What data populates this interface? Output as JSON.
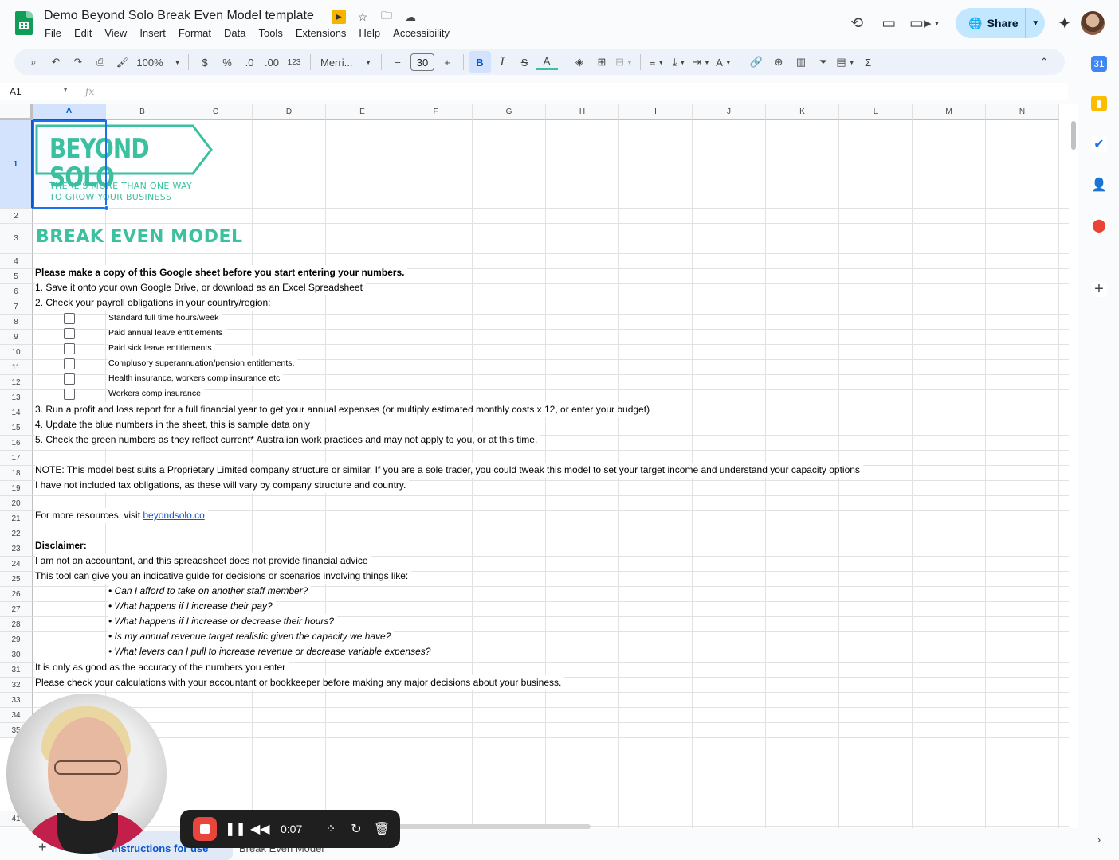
{
  "app": {
    "title": "Demo Beyond Solo Break Even Model template",
    "menu": [
      "File",
      "Edit",
      "View",
      "Insert",
      "Format",
      "Data",
      "Tools",
      "Extensions",
      "Help",
      "Accessibility"
    ],
    "share_label": "Share"
  },
  "toolbar": {
    "zoom": "100%",
    "currency": "$",
    "percent": "%",
    "dec_decrease": ".0",
    "dec_increase": ".00",
    "number_format": "123",
    "font": "Merri...",
    "font_size": "30",
    "bold": "B",
    "italic": "I",
    "strike": "S",
    "text_color": "A"
  },
  "formula": {
    "cell_ref": "A1",
    "fx": "fx"
  },
  "columns": [
    "A",
    "B",
    "C",
    "D",
    "E",
    "F",
    "G",
    "H",
    "I",
    "J",
    "K",
    "L",
    "M",
    "N"
  ],
  "rows": [
    "1",
    "2",
    "3",
    "4",
    "5",
    "6",
    "7",
    "8",
    "9",
    "10",
    "11",
    "12",
    "13",
    "14",
    "15",
    "16",
    "17",
    "18",
    "19",
    "20",
    "21",
    "22",
    "23",
    "24",
    "25",
    "26",
    "27",
    "28",
    "29",
    "30",
    "31",
    "32",
    "33",
    "34",
    "35",
    "41"
  ],
  "logo": {
    "name": "BEYOND SOLO",
    "tagline1": "THERE'S MORE THAN ONE WAY",
    "tagline2": "TO GROW YOUR BUSINESS"
  },
  "content": {
    "title": "BREAK EVEN MODEL",
    "r5": "Please make a copy of this Google sheet before you start entering your numbers.",
    "r6": "1. Save it onto your own Google Drive, or download as an Excel Spreadsheet",
    "r7": "2. Check your payroll obligations in your country/region:",
    "checklist": [
      "Standard full time hours/week",
      "Paid annual leave entitlements",
      "Paid sick leave entitlements",
      "Complusory superannuation/pension entitlements,",
      "Health insurance, workers comp insurance etc",
      "Workers comp insurance"
    ],
    "r14": "3. Run a profit and loss report for a full financial year to get your annual expenses (or multiply estimated monthly costs x 12, or enter your budget)",
    "r15": "4. Update the blue numbers in the sheet, this is sample data only",
    "r16": "5. Check the green numbers as they reflect current* Australian work practices and may not apply to you, or at this time.",
    "r18": "NOTE: This model best suits a Proprietary Limited company structure or similar. If you are a sole trader, you could tweak this model to set your target income and understand your capacity options",
    "r19": "I have not included tax obligations, as these will vary by company structure and country.",
    "r21_prefix": "For more resources, visit ",
    "r21_link": "beyondsolo.co",
    "r23": "Disclaimer:",
    "r24": "I am not an accountant, and this spreadsheet does not provide financial advice",
    "r25": "This tool can give you an indicative guide for decisions or scenarios involving things like:",
    "bullets": [
      "• Can I afford to take on another staff member?",
      "• What happens if I increase their pay?",
      "• What happens if I increase or decrease their hours?",
      "• Is my annual revenue target realistic given the capacity we have?",
      "• What levers can I pull to increase revenue or decrease variable expenses?"
    ],
    "r31": "It is only as good as the accuracy of the numbers you enter",
    "r32": "Please check your calculations with your accountant or bookkeeper before making any major decisions about your business."
  },
  "sheet_tabs": [
    "Instructions for use",
    "Break Even Model"
  ],
  "recorder": {
    "time": "0:07"
  },
  "colors": {
    "brand_teal": "#3cc1a0",
    "selection_blue": "#1a73e8",
    "share_bg": "#c2e7ff",
    "record_red": "#e8453c"
  }
}
